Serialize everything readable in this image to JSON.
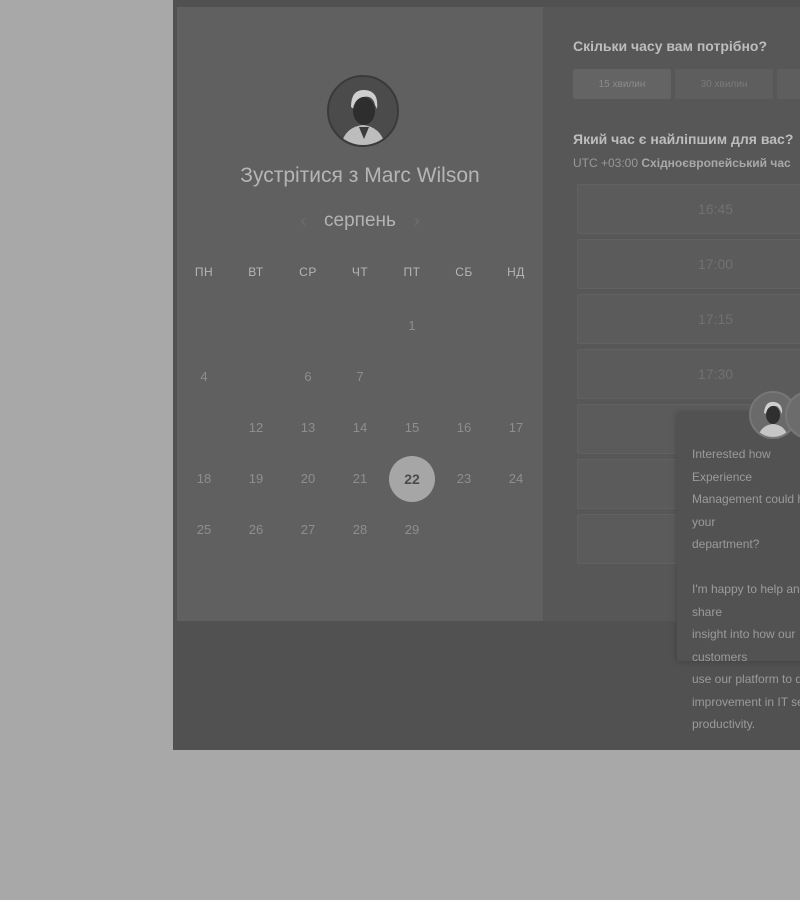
{
  "scheduler": {
    "title": "Зустрітися з Marc Wilson",
    "month": "серпень",
    "weekdays": [
      "ПН",
      "ВТ",
      "СР",
      "ЧТ",
      "ПТ",
      "СБ",
      "НД"
    ],
    "weeks": [
      [
        null,
        null,
        null,
        null,
        "1",
        null,
        null
      ],
      [
        "4",
        null,
        "6",
        "7",
        null,
        null,
        null
      ],
      [
        null,
        "12",
        "13",
        "14",
        "15",
        "16",
        "17"
      ],
      [
        "18",
        "19",
        "20",
        "21",
        "22",
        "23",
        "24"
      ],
      [
        "25",
        "26",
        "27",
        "28",
        "29",
        null,
        null
      ]
    ],
    "selected_day": "22",
    "duration_question": "Скільки часу вам потрібно?",
    "durations": [
      "15 хвилин",
      "30 хвилин"
    ],
    "time_question": "Який час є найліпшим для вас?",
    "timezone_offset": "UTC +03:00",
    "timezone_name": "Східноєвропейський час",
    "time_slots": [
      "16:45",
      "17:00",
      "17:15",
      "17:30"
    ]
  },
  "chat_popup": {
    "message": "Interested how Experience\nManagement could help your\ndepartment?\n\nI'm happy to help and share\ninsight into how our customers\nuse our platform to drive\nimprovement in IT service\nproductivity."
  },
  "colors": {
    "page_bg": "#a8a8a8",
    "modal_bg": "#515151",
    "left_panel_bg": "#606060",
    "selected_day_bg": "#a6a6a6"
  }
}
